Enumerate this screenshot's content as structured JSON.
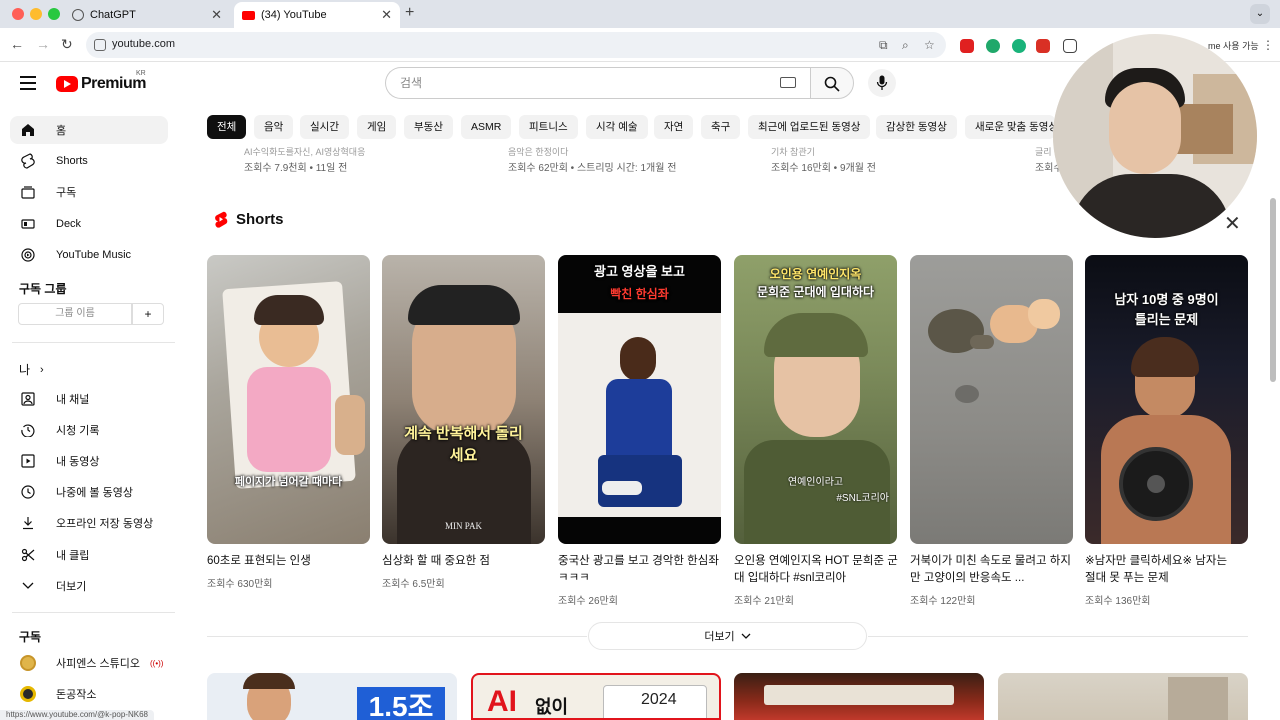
{
  "browser": {
    "tabs": [
      {
        "title": "ChatGPT",
        "active": false
      },
      {
        "title": "(34) YouTube",
        "active": true
      }
    ],
    "url": "youtube.com",
    "profile_text": "me 사용 가능",
    "status_url": "https://www.youtube.com/@k-pop-NK68"
  },
  "header": {
    "logo_word": "Premium",
    "logo_region": "KR",
    "search_placeholder": "검색"
  },
  "sidebar": {
    "main": [
      {
        "label": "홈",
        "icon": "home-icon",
        "active": true
      },
      {
        "label": "Shorts",
        "icon": "shorts-icon"
      },
      {
        "label": "구독",
        "icon": "subscriptions-icon"
      },
      {
        "label": "Deck",
        "icon": "deck-icon"
      },
      {
        "label": "YouTube Music",
        "icon": "youtube-music-icon"
      }
    ],
    "group_title": "구독 그룹",
    "group_placeholder": "그룹 이름",
    "group_add": "+",
    "you_title": "나",
    "you_items": [
      {
        "label": "내 채널",
        "icon": "channel-icon"
      },
      {
        "label": "시청 기록",
        "icon": "history-icon"
      },
      {
        "label": "내 동영상",
        "icon": "my-videos-icon"
      },
      {
        "label": "나중에 볼 동영상",
        "icon": "watch-later-icon"
      },
      {
        "label": "오프라인 저장 동영상",
        "icon": "download-icon"
      },
      {
        "label": "내 클립",
        "icon": "clips-icon"
      },
      {
        "label": "더보기",
        "icon": "chevron-down-icon"
      }
    ],
    "subs_title": "구독",
    "subs": [
      {
        "label": "사피엔스 스튜디오",
        "live": "((•))"
      },
      {
        "label": "돈공작소"
      }
    ]
  },
  "chips": [
    "전체",
    "음악",
    "실시간",
    "게임",
    "부동산",
    "ASMR",
    "피트니스",
    "시각 예술",
    "자연",
    "축구",
    "최근에 업로드된 동영상",
    "감상한 동영상",
    "새로운 맞춤 동영상"
  ],
  "top_meta": [
    {
      "cut": "AI수익화도를자신, AI영상혁대응",
      "meta": "조회수 7.9천회 • 11일 전"
    },
    {
      "cut": "음악은 한정이다",
      "meta": "조회수 62만회 • 스트리밍 시간: 1개월 전"
    },
    {
      "cut": "기차 참관기",
      "meta": "조회수 16만회 • 9개월 전"
    },
    {
      "cut": "글리",
      "meta": "조회수"
    }
  ],
  "shorts": {
    "title": "Shorts",
    "items": [
      {
        "title": "60초로 표현되는 인생",
        "views": "조회수 630만회",
        "caption": "페이지가 넘어갈 때마다"
      },
      {
        "title": "심상화 할 때 중요한 점",
        "views": "조회수 6.5만회",
        "caption": "계속 반복해서 돌리세요",
        "watermark": "MIN PAK"
      },
      {
        "title": "중국산 광고를 보고 경악한 한심좌 ㅋㅋㅋ",
        "views": "조회수 26만회",
        "caption_top_a": "광고 영상을 보고",
        "caption_top_b": "빡친 한심좌"
      },
      {
        "title": "오인용 연예인지옥 HOT 문희준 군대 입대하다 #snl코리아",
        "views": "조회수 21만회",
        "caption_top_a": "오인용 연예인지옥",
        "caption_top_b": "문희준 군대에 입대하다",
        "caption_low": "연예인이라고",
        "tag": "#SNL코리아"
      },
      {
        "title": "거북이가 미친 속도로 물려고 하지만 고양이의 반응속도 ...",
        "views": "조회수 122만회"
      },
      {
        "title": "※남자만 클릭하세요※ 남자는 절대 못 푸는 문제",
        "views": "조회수 136만회",
        "caption_top_a": "남자 10명 중 9명이",
        "caption_top_b": "틀리는 문제"
      }
    ],
    "more": "더보기"
  },
  "bottom_thumbs": [
    {
      "text": "1.5조"
    },
    {
      "text_a": "AI",
      "text_b": "없이",
      "text_c": "2024"
    }
  ]
}
